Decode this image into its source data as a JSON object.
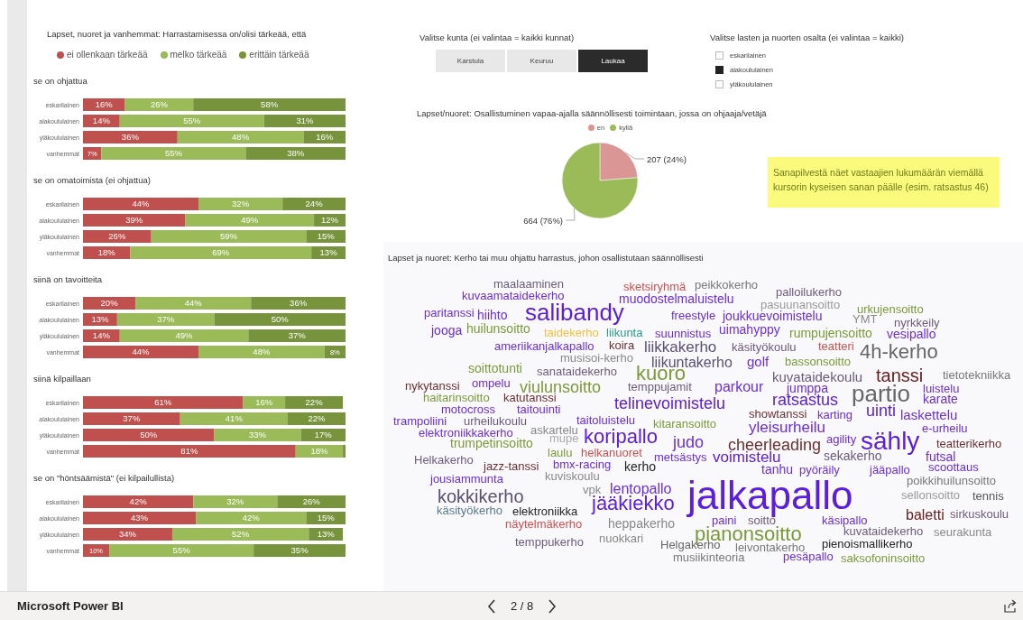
{
  "left_panel": {
    "title": "Lapset, nuoret ja vanhemmat: Harrastamisessa on/olisi tärkeää, että",
    "legend": [
      {
        "label": "ei ollenkaan tärkeää",
        "color": "#c0504d"
      },
      {
        "label": "melko tärkeää",
        "color": "#9bbb59"
      },
      {
        "label": "erittäin tärkeää",
        "color": "#77933c"
      }
    ],
    "charts": [
      {
        "chart_data": {
          "type": "bar",
          "title": "se on ohjattua",
          "orientation": "horizontal",
          "stacked": true,
          "categories": [
            "eskarilainen",
            "alakoululainen",
            "yläkoululainen",
            "vanhemmat"
          ],
          "series": [
            {
              "color": "#c0504d",
              "values": [
                16,
                14,
                36,
                7
              ],
              "value_labels": [
                "16%",
                "14%",
                "36%",
                "7%"
              ]
            },
            {
              "color": "#9bbb59",
              "values": [
                26,
                55,
                48,
                55
              ],
              "value_labels": [
                "26%",
                "55%",
                "48%",
                "55%"
              ]
            },
            {
              "color": "#77933c",
              "values": [
                58,
                31,
                16,
                38
              ],
              "value_labels": [
                "58%",
                "31%",
                "16%",
                "38%"
              ]
            }
          ]
        }
      },
      {
        "chart_data": {
          "type": "bar",
          "title": "se on omatoimista (ei ohjattua)",
          "orientation": "horizontal",
          "stacked": true,
          "categories": [
            "eskarilainen",
            "alakoululainen",
            "yläkoululainen",
            "vanhemmat"
          ],
          "series": [
            {
              "color": "#c0504d",
              "values": [
                44,
                39,
                26,
                18
              ],
              "value_labels": [
                "44%",
                "39%",
                "26%",
                "18%"
              ]
            },
            {
              "color": "#9bbb59",
              "values": [
                32,
                49,
                59,
                69
              ],
              "value_labels": [
                "32%",
                "49%",
                "59%",
                "69%"
              ]
            },
            {
              "color": "#77933c",
              "values": [
                24,
                12,
                15,
                13
              ],
              "value_labels": [
                "24%",
                "12%",
                "15%",
                "13%"
              ]
            }
          ]
        }
      },
      {
        "chart_data": {
          "type": "bar",
          "title": "siinä on tavoitteita",
          "orientation": "horizontal",
          "stacked": true,
          "categories": [
            "eskarilainen",
            "alakoululainen",
            "yläkoululainen",
            "vanhemmat"
          ],
          "series": [
            {
              "color": "#c0504d",
              "values": [
                20,
                13,
                14,
                44
              ],
              "value_labels": [
                "20%",
                "13%",
                "14%",
                "44%"
              ]
            },
            {
              "color": "#9bbb59",
              "values": [
                44,
                37,
                49,
                48
              ],
              "value_labels": [
                "44%",
                "37%",
                "49%",
                "48%"
              ]
            },
            {
              "color": "#77933c",
              "values": [
                36,
                50,
                37,
                8
              ],
              "value_labels": [
                "36%",
                "50%",
                "37%",
                "8%"
              ]
            }
          ]
        }
      },
      {
        "chart_data": {
          "type": "bar",
          "title": "siinä kilpaillaan",
          "orientation": "horizontal",
          "stacked": true,
          "categories": [
            "eskarilainen",
            "alakoululainen",
            "yläkoululainen",
            "vanhemmat"
          ],
          "series": [
            {
              "color": "#c0504d",
              "values": [
                61,
                37,
                50,
                81
              ],
              "value_labels": [
                "61%",
                "37%",
                "50%",
                "81%"
              ]
            },
            {
              "color": "#9bbb59",
              "values": [
                16,
                41,
                33,
                18
              ],
              "value_labels": [
                "16%",
                "41%",
                "33%",
                "18%"
              ]
            },
            {
              "color": "#77933c",
              "values": [
                22,
                22,
                17,
                1
              ],
              "value_labels": [
                "22%",
                "22%",
                "17%",
                null
              ]
            }
          ]
        }
      },
      {
        "chart_data": {
          "type": "bar",
          "title": "se on \"höntsäämistä\" (ei kilpailullista)",
          "orientation": "horizontal",
          "stacked": true,
          "categories": [
            "eskarilainen",
            "alakoululainen",
            "yläkoululainen",
            "vanhemmat"
          ],
          "series": [
            {
              "color": "#c0504d",
              "values": [
                42,
                43,
                34,
                10
              ],
              "value_labels": [
                "42%",
                "43%",
                "34%",
                "10%"
              ]
            },
            {
              "color": "#9bbb59",
              "values": [
                32,
                42,
                52,
                55
              ],
              "value_labels": [
                "32%",
                "42%",
                "52%",
                "55%"
              ]
            },
            {
              "color": "#77933c",
              "values": [
                26,
                15,
                13,
                35
              ],
              "value_labels": [
                "26%",
                "15%",
                "13%",
                "35%"
              ]
            }
          ]
        }
      }
    ]
  },
  "municipality_slicer": {
    "title": "Valitse kunta (ei valintaa = kaikki kunnat)",
    "options": [
      {
        "label": "Karstula",
        "selected": false
      },
      {
        "label": "Keuruu",
        "selected": false
      },
      {
        "label": "Laukaa",
        "selected": true
      }
    ]
  },
  "group_slicer": {
    "title": "Valitse lasten ja nuorten osalta (ei valintaa = kaikki)",
    "options": [
      {
        "label": "eskarilainen",
        "checked": false
      },
      {
        "label": "alakoululainen",
        "checked": true
      },
      {
        "label": "yläkoululainen",
        "checked": false
      }
    ]
  },
  "participation_chart": {
    "title": "Lapset/nuoret: Osallistuminen vapaa-ajalla säännöllisesti toimintaan, jossa on ohjaaja/vetäjä",
    "legend": [
      {
        "label": "en",
        "color": "#d99694"
      },
      {
        "label": "kyllä",
        "color": "#9bbb59"
      }
    ],
    "chart_data": {
      "type": "pie",
      "values": [
        207,
        664
      ],
      "value_labels": [
        "207 (24%)",
        "664 (76%)"
      ]
    }
  },
  "note": {
    "text": "Sanapilvestä näet vastaajien lukumäärän viemällä kursorin kyseisen sanan päälle (esim. ratsastus 46)"
  },
  "word_cloud": {
    "title": "Lapset ja nuoret: Kerho tai muu ohjattu harrastus, johon osallistutaan säännöllisesti",
    "words": [
      {
        "text": "maalaaminen",
        "color": "#6b5b7b"
      },
      {
        "text": "sketsiryhmä",
        "color": "#d05050"
      },
      {
        "text": "peikkokerho",
        "color": "#777777"
      },
      {
        "text": "kuvaamataidekerho",
        "color": "#6a2ee0"
      },
      {
        "text": "muodostelmaluistelu",
        "color": "#6a2ee0"
      },
      {
        "text": "palloilukerho",
        "color": "#6b5b7b"
      },
      {
        "text": "pasuunansoitto",
        "color": "#999999"
      },
      {
        "text": "paritanssi",
        "color": "#6a2ee0"
      },
      {
        "text": "hiihto",
        "color": "#6a2ee0"
      },
      {
        "text": "salibandy",
        "color": "#5b1ee0"
      },
      {
        "text": "freestyle",
        "color": "#6a2ee0"
      },
      {
        "text": "joukkuevoimistelu",
        "color": "#6a2ee0"
      },
      {
        "text": "urkujensoitto",
        "color": "#7a9a3a"
      },
      {
        "text": "YMT",
        "color": "#888888"
      },
      {
        "text": "nyrkkeily",
        "color": "#6b5b7b"
      },
      {
        "text": "jooga",
        "color": "#6a2ee0"
      },
      {
        "text": "huilunsoitto",
        "color": "#7a9a3a"
      },
      {
        "text": "taidekerho",
        "color": "#f0c040"
      },
      {
        "text": "liikunta",
        "color": "#2a9a8a"
      },
      {
        "text": "suunnistus",
        "color": "#6a2ee0"
      },
      {
        "text": "uimahyppy",
        "color": "#6a2ee0"
      },
      {
        "text": "rumpujensoitto",
        "color": "#7a9a3a"
      },
      {
        "text": "vesipallo",
        "color": "#6a2ee0"
      },
      {
        "text": "ameriikanjalkapallo",
        "color": "#6a2ee0"
      },
      {
        "text": "koira",
        "color": "#6a3030"
      },
      {
        "text": "liikkakerho",
        "color": "#5a5070"
      },
      {
        "text": "käsityökoulu",
        "color": "#6b5b7b"
      },
      {
        "text": "teatteri",
        "color": "#d05050"
      },
      {
        "text": "musisoi-kerho",
        "color": "#888888"
      },
      {
        "text": "4h-kerho",
        "color": "#666666"
      },
      {
        "text": "liikuntakerho",
        "color": "#5a5070"
      },
      {
        "text": "golf",
        "color": "#6a2ee0"
      },
      {
        "text": "bassonsoitto",
        "color": "#7a9a3a"
      },
      {
        "text": "soittotunti",
        "color": "#7a9a3a"
      },
      {
        "text": "sanataidekerho",
        "color": "#6b5b7b"
      },
      {
        "text": "kuoro",
        "color": "#7a9a3a"
      },
      {
        "text": "kuvataidekoulu",
        "color": "#6b5b7b"
      },
      {
        "text": "tanssi",
        "color": "#6a2020"
      },
      {
        "text": "tietotekniikka",
        "color": "#777777"
      },
      {
        "text": "nykytanssi",
        "color": "#6a3030"
      },
      {
        "text": "ompelu",
        "color": "#6a2ee0"
      },
      {
        "text": "viulunsoitto",
        "color": "#7a9a3a"
      },
      {
        "text": "temppujamit",
        "color": "#6b5b7b"
      },
      {
        "text": "parkour",
        "color": "#6a2ee0"
      },
      {
        "text": "jumppa",
        "color": "#6a2ee0"
      },
      {
        "text": "partio",
        "color": "#666666"
      },
      {
        "text": "luistelu",
        "color": "#6a2ee0"
      },
      {
        "text": "haitarinsoitto",
        "color": "#7a9a3a"
      },
      {
        "text": "katutanssi",
        "color": "#6a3030"
      },
      {
        "text": "telinevoimistelu",
        "color": "#5b1ee0"
      },
      {
        "text": "ratsastus",
        "color": "#5b1ee0"
      },
      {
        "text": "karate",
        "color": "#6a2ee0"
      },
      {
        "text": "motocross",
        "color": "#6a2ee0"
      },
      {
        "text": "taitouinti",
        "color": "#6a2ee0"
      },
      {
        "text": "showtanssi",
        "color": "#6a3030"
      },
      {
        "text": "karting",
        "color": "#6a2ee0"
      },
      {
        "text": "uinti",
        "color": "#5b1ee0"
      },
      {
        "text": "laskettelu",
        "color": "#6a2ee0"
      },
      {
        "text": "trampoliini",
        "color": "#6a2ee0"
      },
      {
        "text": "urheilukoulu",
        "color": "#6b5b7b"
      },
      {
        "text": "taitoluistelu",
        "color": "#6a2ee0"
      },
      {
        "text": "kitaransoitto",
        "color": "#7a9a3a"
      },
      {
        "text": "elektroniikkakerho",
        "color": "#6a2ee0"
      },
      {
        "text": "askartelu",
        "color": "#888888"
      },
      {
        "text": "koripallo",
        "color": "#5b1ee0"
      },
      {
        "text": "yleisurheilu",
        "color": "#6a2ee0"
      },
      {
        "text": "e-urheilu",
        "color": "#6a2ee0"
      },
      {
        "text": "trumpetinsoitto",
        "color": "#7a9a3a"
      },
      {
        "text": "mupe",
        "color": "#aaaaaa"
      },
      {
        "text": "judo",
        "color": "#6a2ee0"
      },
      {
        "text": "cheerleading",
        "color": "#6a3030"
      },
      {
        "text": "agility",
        "color": "#6a2ee0"
      },
      {
        "text": "sähly",
        "color": "#5b1ee0"
      },
      {
        "text": "teatterikerho",
        "color": "#6a3030"
      },
      {
        "text": "Helkakerho",
        "color": "#6b5b7b"
      },
      {
        "text": "laulu",
        "color": "#7a9a3a"
      },
      {
        "text": "helkanuoret",
        "color": "#d05050"
      },
      {
        "text": "metsästys",
        "color": "#6a2ee0"
      },
      {
        "text": "voimistelu",
        "color": "#5b1ee0"
      },
      {
        "text": "sekakerho",
        "color": "#6b5b7b"
      },
      {
        "text": "futsal",
        "color": "#6a2ee0"
      },
      {
        "text": "jazz-tanssi",
        "color": "#6a3030"
      },
      {
        "text": "bmx-racing",
        "color": "#6a2ee0"
      },
      {
        "text": "kerho",
        "color": "#222222"
      },
      {
        "text": "tanhu",
        "color": "#6a2ee0"
      },
      {
        "text": "pyöräily",
        "color": "#6a2ee0"
      },
      {
        "text": "jääpallo",
        "color": "#6a2ee0"
      },
      {
        "text": "scoottaus",
        "color": "#6a2ee0"
      },
      {
        "text": "jousiammunta",
        "color": "#6a2ee0"
      },
      {
        "text": "kuviskoulu",
        "color": "#888888"
      },
      {
        "text": "jalkapallo",
        "color": "#5b1ee0"
      },
      {
        "text": "poikkihuilunsoitto",
        "color": "#777777"
      },
      {
        "text": "kokkikerho",
        "color": "#5a5070"
      },
      {
        "text": "vpk",
        "color": "#888888"
      },
      {
        "text": "lentopallo",
        "color": "#6a2ee0"
      },
      {
        "text": "jääkiekko",
        "color": "#5b1ee0"
      },
      {
        "text": "sellonsoitto",
        "color": "#999999"
      },
      {
        "text": "tennis",
        "color": "#555555"
      },
      {
        "text": "käsityökerho",
        "color": "#5a7a8a"
      },
      {
        "text": "elektroniikka",
        "color": "#222222"
      },
      {
        "text": "paini",
        "color": "#6a2ee0"
      },
      {
        "text": "soitto",
        "color": "#6b5b7b"
      },
      {
        "text": "käsipallo",
        "color": "#6a2ee0"
      },
      {
        "text": "baletti",
        "color": "#6a2020"
      },
      {
        "text": "sirkuskoulu",
        "color": "#6b5b7b"
      },
      {
        "text": "näytelmäkerho",
        "color": "#d05050"
      },
      {
        "text": "heppakerho",
        "color": "#888888"
      },
      {
        "text": "pianonsoitto",
        "color": "#7a9a3a"
      },
      {
        "text": "kuvataidekerho",
        "color": "#6b5b7b"
      },
      {
        "text": "seurakunta",
        "color": "#888888"
      },
      {
        "text": "temppukerho",
        "color": "#6b5b7b"
      },
      {
        "text": "nuokkari",
        "color": "#888888"
      },
      {
        "text": "Helgakerho",
        "color": "#666666"
      },
      {
        "text": "leivontakerho",
        "color": "#777777"
      },
      {
        "text": "pienoismallikerho",
        "color": "#222222"
      },
      {
        "text": "musiikinteoria",
        "color": "#777777"
      },
      {
        "text": "pesäpallo",
        "color": "#6a2ee0"
      },
      {
        "text": "saksofoninsoitto",
        "color": "#7a9a3a"
      }
    ]
  },
  "footer": {
    "app_name": "Microsoft Power BI",
    "page_indicator": "2 / 8"
  }
}
